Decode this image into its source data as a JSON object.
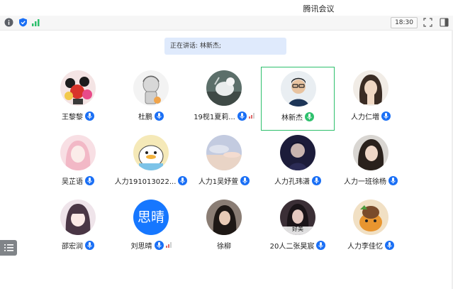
{
  "window": {
    "title": "腾讯会议"
  },
  "toolbar": {
    "time": "18:30"
  },
  "speaking": {
    "text": "正在讲话: 林新杰;"
  },
  "colors": {
    "mic_blue": "#1a6ff5",
    "speaking_green": "#2ec06d",
    "banner_bg": "#dfeafc"
  },
  "participants": [
    {
      "name": "王黎黎"
    },
    {
      "name": "杜鹏"
    },
    {
      "name": "19枧1夏莉..."
    },
    {
      "name": "林新杰"
    },
    {
      "name": "人力仁増"
    },
    {
      "name": "吴芷语"
    },
    {
      "name": "人力191013022..."
    },
    {
      "name": "人力1吴妤萱"
    },
    {
      "name": "人力孔玮潇"
    },
    {
      "name": "人力一班徐杨"
    },
    {
      "name": "邵宏润"
    },
    {
      "name": "刘思晴",
      "avatar_text": "思晴"
    },
    {
      "name": "徐柳"
    },
    {
      "name": "20人二张昊宸",
      "avatar_caption": "好美"
    },
    {
      "name": "人力李佳忆"
    }
  ]
}
